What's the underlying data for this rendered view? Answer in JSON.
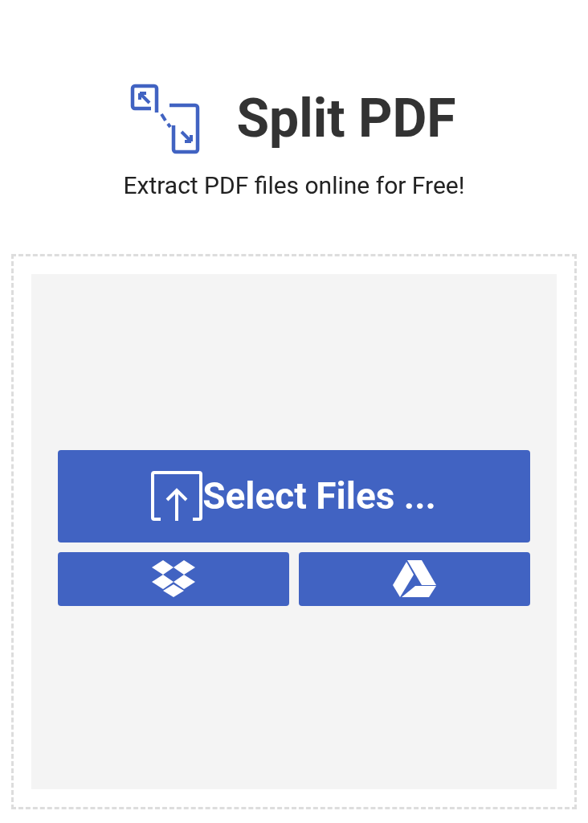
{
  "header": {
    "title": "Split PDF",
    "subtitle": "Extract PDF files online for Free!"
  },
  "upload": {
    "button": "Select Files ...",
    "cloud_buttons": [
      {
        "kind": "dropbox"
      },
      {
        "kind": "drive"
      }
    ]
  }
}
